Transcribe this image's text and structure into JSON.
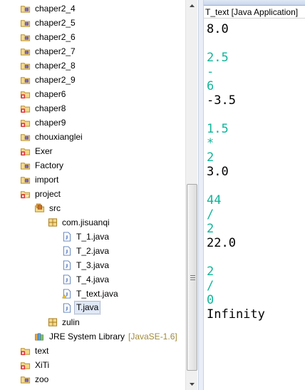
{
  "explorer": {
    "items": [
      {
        "label": "chaper2_4",
        "icon": "package-folder-icon",
        "indent": 1
      },
      {
        "label": "chaper2_5",
        "icon": "package-folder-icon",
        "indent": 1
      },
      {
        "label": "chaper2_6",
        "icon": "package-folder-icon",
        "indent": 1
      },
      {
        "label": "chaper2_7",
        "icon": "package-folder-icon",
        "indent": 1
      },
      {
        "label": "chaper2_8",
        "icon": "package-folder-icon",
        "indent": 1
      },
      {
        "label": "chaper2_9",
        "icon": "package-folder-icon",
        "indent": 1
      },
      {
        "label": "chaper6",
        "icon": "project-error-icon",
        "indent": 1
      },
      {
        "label": "chaper8",
        "icon": "project-error-icon",
        "indent": 1
      },
      {
        "label": "chaper9",
        "icon": "project-error-icon",
        "indent": 1
      },
      {
        "label": "chouxianglei",
        "icon": "package-folder-icon",
        "indent": 1
      },
      {
        "label": "Exer",
        "icon": "project-error-icon",
        "indent": 1
      },
      {
        "label": "Factory",
        "icon": "package-folder-icon",
        "indent": 1
      },
      {
        "label": "import",
        "icon": "package-folder-icon",
        "indent": 1
      },
      {
        "label": "project",
        "icon": "project-open-error-icon",
        "indent": 1
      },
      {
        "label": "src",
        "icon": "source-folder-icon",
        "indent": 2
      },
      {
        "label": "com.jisuanqi",
        "icon": "package-icon",
        "indent": 3
      },
      {
        "label": "T_1.java",
        "icon": "java-file-icon",
        "indent": 4
      },
      {
        "label": "T_2.java",
        "icon": "java-file-icon",
        "indent": 4
      },
      {
        "label": "T_3.java",
        "icon": "java-file-icon",
        "indent": 4
      },
      {
        "label": "T_4.java",
        "icon": "java-file-icon",
        "indent": 4
      },
      {
        "label": "T_text.java",
        "icon": "java-file-warning-icon",
        "indent": 4
      },
      {
        "label": "T.java",
        "icon": "java-file-icon",
        "indent": 4,
        "selected": true
      },
      {
        "label": "zulin",
        "icon": "package-icon",
        "indent": 3
      },
      {
        "label": "JRE System Library",
        "tag": "[JavaSE-1.6]",
        "icon": "library-icon",
        "indent": 2
      },
      {
        "label": "text",
        "icon": "project-error-icon",
        "indent": 1
      },
      {
        "label": "XiTi",
        "icon": "project-error-icon",
        "indent": 1
      },
      {
        "label": "zoo",
        "icon": "package-folder-icon",
        "indent": 1
      }
    ]
  },
  "console": {
    "title": "T_text [Java Application]",
    "lines": [
      {
        "text": "8.0",
        "kind": "out"
      },
      {
        "text": "",
        "kind": "out"
      },
      {
        "text": "2.5",
        "kind": "in"
      },
      {
        "text": "-",
        "kind": "in"
      },
      {
        "text": "6",
        "kind": "in"
      },
      {
        "text": "-3.5",
        "kind": "out"
      },
      {
        "text": "",
        "kind": "out"
      },
      {
        "text": "1.5",
        "kind": "in"
      },
      {
        "text": "*",
        "kind": "in"
      },
      {
        "text": "2",
        "kind": "in"
      },
      {
        "text": "3.0",
        "kind": "out"
      },
      {
        "text": "",
        "kind": "out"
      },
      {
        "text": "44",
        "kind": "in"
      },
      {
        "text": "/",
        "kind": "in"
      },
      {
        "text": "2",
        "kind": "in"
      },
      {
        "text": "22.0",
        "kind": "out"
      },
      {
        "text": "",
        "kind": "out"
      },
      {
        "text": "2",
        "kind": "in"
      },
      {
        "text": "/",
        "kind": "in"
      },
      {
        "text": "0",
        "kind": "in"
      },
      {
        "text": "Infinity",
        "kind": "out"
      }
    ]
  },
  "colors": {
    "input_text": "#12b59a",
    "output_text": "#000000",
    "selection": "#dfe8f6",
    "library_tag": "#a08a3c"
  }
}
